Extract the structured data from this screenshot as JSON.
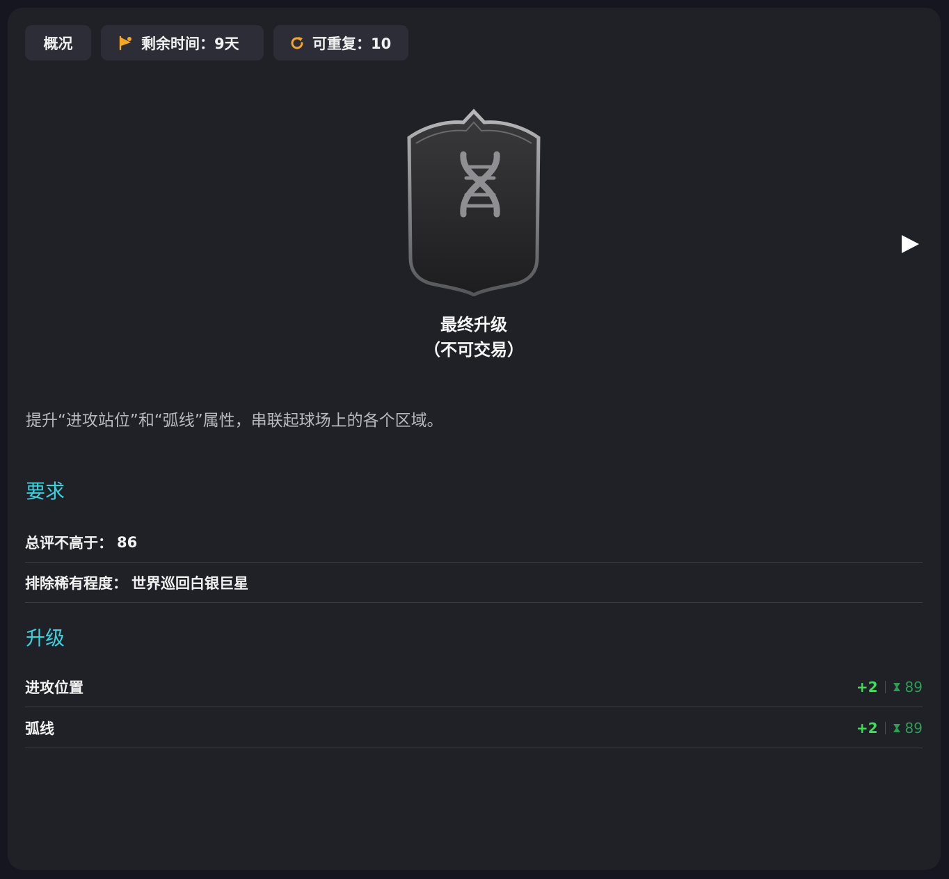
{
  "header": {
    "overview_label": "概况",
    "time_label": "剩余时间：9天",
    "repeat_label": "可重复：10"
  },
  "card": {
    "icon": "dna-icon",
    "title_line1": "最终升级",
    "title_line2": "（不可交易）"
  },
  "description": "提升“进攻站位”和“弧线”属性，串联起球场上的各个区域。",
  "requirements": {
    "title": "要求",
    "items": [
      {
        "label": "总评不高于：",
        "value": "86"
      },
      {
        "label": "排除稀有程度：",
        "value": "世界巡回白银巨星"
      }
    ]
  },
  "upgrades": {
    "title": "升级",
    "items": [
      {
        "label": "进攻位置",
        "delta": "+2",
        "cap": "89"
      },
      {
        "label": "弧线",
        "delta": "+2",
        "cap": "89"
      }
    ]
  },
  "colors": {
    "accent": "#38d3e0",
    "chip_icon": "#f5a623",
    "delta_green": "#3fdd5c",
    "cap_green": "#2e9e57"
  }
}
